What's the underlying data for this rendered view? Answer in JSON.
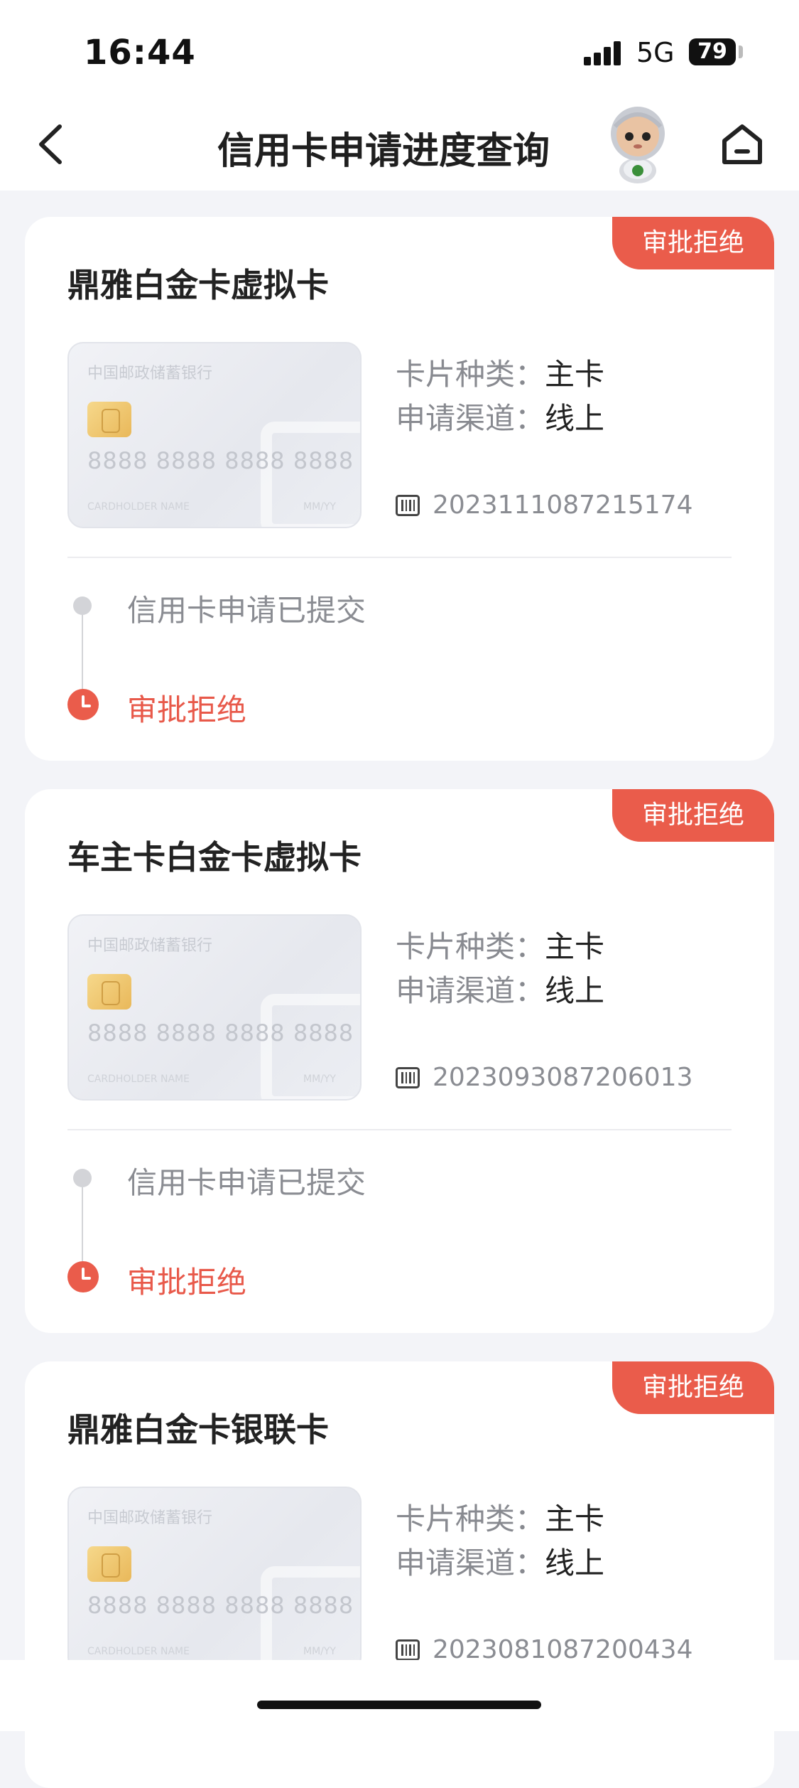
{
  "status": {
    "time": "16:44",
    "network": "5G",
    "battery": "79"
  },
  "nav": {
    "title": "信用卡申请进度查询"
  },
  "labels": {
    "card_type": "卡片种类：",
    "channel": "申请渠道："
  },
  "card_art": {
    "bank": "中国邮政储蓄银行",
    "number": "8888 8888 8888 8888",
    "holder": "CARDHOLDER NAME",
    "expiry": "MM/YY"
  },
  "applications": [
    {
      "title": "鼎雅白金卡虚拟卡",
      "badge": "审批拒绝",
      "card_type": "主卡",
      "channel": "线上",
      "app_no": "2023111087215174",
      "steps": [
        "信用卡申请已提交",
        "审批拒绝"
      ]
    },
    {
      "title": "车主卡白金卡虚拟卡",
      "badge": "审批拒绝",
      "card_type": "主卡",
      "channel": "线上",
      "app_no": "2023093087206013",
      "steps": [
        "信用卡申请已提交",
        "审批拒绝"
      ]
    },
    {
      "title": "鼎雅白金卡银联卡",
      "badge": "审批拒绝",
      "card_type": "主卡",
      "channel": "线上",
      "app_no": "2023081087200434",
      "steps": []
    }
  ],
  "colors": {
    "accent": "#ea5c4b",
    "background": "#f3f4f8"
  }
}
